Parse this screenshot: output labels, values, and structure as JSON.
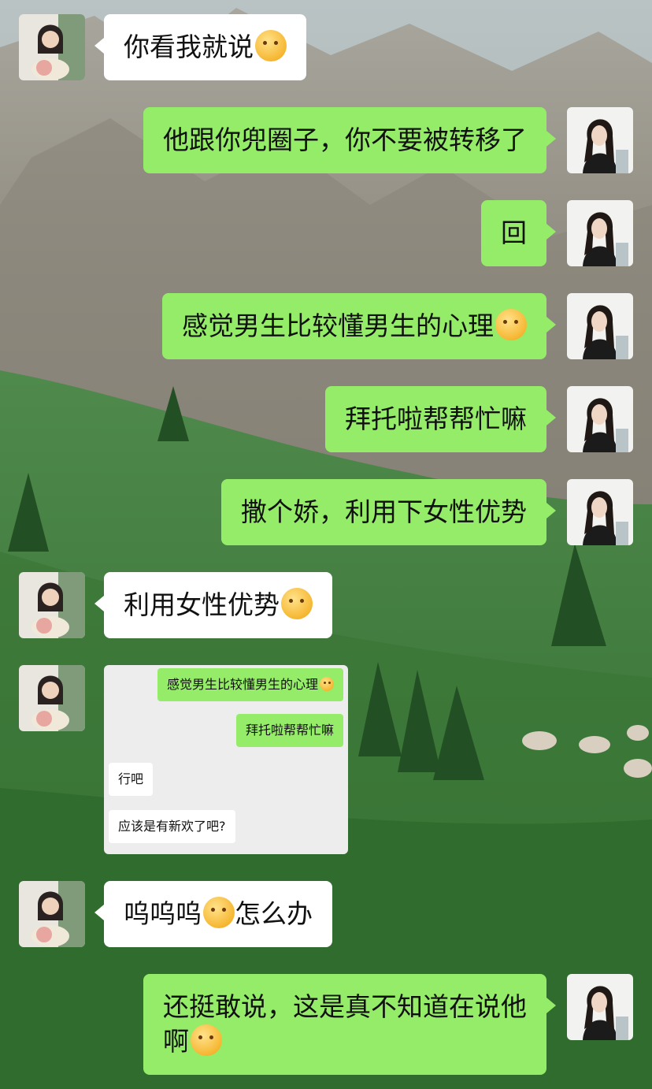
{
  "background": {
    "description_icon": "mountain-meadow-wallpaper"
  },
  "colors": {
    "outgoing_bubble": "#95ec69",
    "incoming_bubble": "#ffffff",
    "screenshot_bg": "#ededed"
  },
  "messages": [
    {
      "side": "in",
      "text": "你看我就说",
      "emoji": "face-with-hand-over-mouth"
    },
    {
      "side": "out",
      "text": "他跟你兜圈子，你不要被转移了"
    },
    {
      "side": "out",
      "text": "回"
    },
    {
      "side": "out",
      "text": "感觉男生比较懂男生的心理",
      "emoji": "face-with-hand-over-mouth"
    },
    {
      "side": "out",
      "text": "拜托啦帮帮忙嘛"
    },
    {
      "side": "out",
      "text": "撒个娇，利用下女性优势"
    },
    {
      "side": "in",
      "text": "利用女性优势",
      "emoji": "smiling-face"
    },
    {
      "side": "in",
      "text": "呜呜呜",
      "emoji": "crying-face",
      "text2": "怎么办"
    },
    {
      "side": "out",
      "line1": "还挺敢说，这是真不知道在说他",
      "line2": "啊",
      "emoji": "loudly-crying-face"
    }
  ],
  "screenshot": {
    "messages": [
      {
        "side": "out",
        "text": "感觉男生比较懂男生的心理",
        "emoji": "face-with-hand-over-mouth"
      },
      {
        "side": "out",
        "text": "拜托啦帮帮忙嘛"
      },
      {
        "side": "in",
        "text": "行吧"
      },
      {
        "side": "in",
        "text": "应该是有新欢了吧?"
      }
    ]
  }
}
